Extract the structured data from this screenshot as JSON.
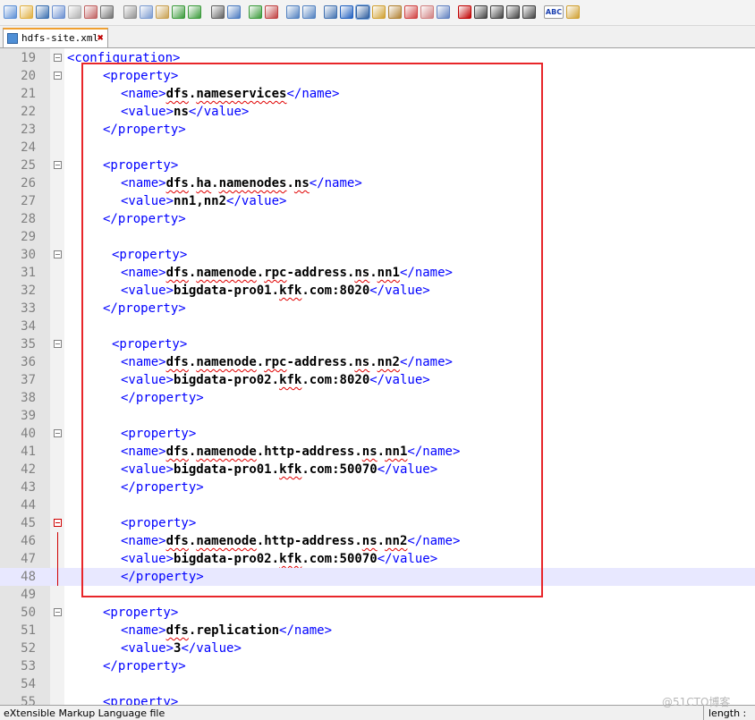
{
  "toolbar": {
    "icons": [
      "new-file-icon",
      "open-file-icon",
      "save-icon",
      "save-all-icon",
      "close-icon",
      "close-all-icon",
      "print-icon",
      "cut-icon",
      "copy-icon",
      "paste-icon",
      "undo-icon",
      "redo-icon",
      "find-icon",
      "replace-icon",
      "zoom-in-icon",
      "zoom-out-icon",
      "sync-vertical-icon",
      "sync-horizontal-icon",
      "word-wrap-icon",
      "show-all-characters-icon",
      "indent-guide-icon",
      "document-map-icon",
      "function-list-icon",
      "launch-icon",
      "folder-workspace-icon",
      "monitoring-icon",
      "record-macro-icon",
      "stop-macro-icon",
      "play-macro-icon",
      "run-macro-multiple-icon",
      "save-macro-icon",
      "spell-check-icon",
      "folder-icon"
    ],
    "spell_check_label": "ABC"
  },
  "tab": {
    "label": "hdfs-site.xml",
    "close_symbol": "✖"
  },
  "editor": {
    "lines": [
      {
        "num": "19",
        "fold": "minus",
        "fold_color": "gray",
        "indent": 0,
        "segments": [
          {
            "t": "tag",
            "v": "<configuration>"
          }
        ]
      },
      {
        "num": "20",
        "fold": "minus",
        "fold_color": "gray",
        "indent": 4,
        "segments": [
          {
            "t": "tag",
            "v": "<property>"
          }
        ]
      },
      {
        "num": "21",
        "fold": "",
        "fold_color": "gray",
        "indent": 6,
        "segments": [
          {
            "t": "tag",
            "v": "<name>"
          },
          {
            "t": "txt",
            "v": "dfs.nameservices"
          },
          {
            "t": "tag",
            "v": "</name>"
          }
        ]
      },
      {
        "num": "22",
        "fold": "",
        "fold_color": "gray",
        "indent": 6,
        "segments": [
          {
            "t": "tag",
            "v": "<value>"
          },
          {
            "t": "txt",
            "v": "ns"
          },
          {
            "t": "tag",
            "v": "</value>"
          }
        ]
      },
      {
        "num": "23",
        "fold": "",
        "fold_color": "gray",
        "indent": 4,
        "segments": [
          {
            "t": "tag",
            "v": "</property>"
          }
        ]
      },
      {
        "num": "24",
        "fold": "",
        "fold_color": "gray",
        "indent": 0,
        "segments": []
      },
      {
        "num": "25",
        "fold": "minus",
        "fold_color": "gray",
        "indent": 4,
        "segments": [
          {
            "t": "tag",
            "v": "<property>"
          }
        ]
      },
      {
        "num": "26",
        "fold": "",
        "fold_color": "gray",
        "indent": 6,
        "segments": [
          {
            "t": "tag",
            "v": "<name>"
          },
          {
            "t": "txt",
            "v": "dfs.ha.namenodes.ns"
          },
          {
            "t": "tag",
            "v": "</name>"
          }
        ]
      },
      {
        "num": "27",
        "fold": "",
        "fold_color": "gray",
        "indent": 6,
        "segments": [
          {
            "t": "tag",
            "v": "<value>"
          },
          {
            "t": "txt",
            "v": "nn1,nn2"
          },
          {
            "t": "tag",
            "v": "</value>"
          }
        ]
      },
      {
        "num": "28",
        "fold": "",
        "fold_color": "gray",
        "indent": 4,
        "segments": [
          {
            "t": "tag",
            "v": "</property>"
          }
        ]
      },
      {
        "num": "29",
        "fold": "",
        "fold_color": "gray",
        "indent": 0,
        "segments": []
      },
      {
        "num": "30",
        "fold": "minus",
        "fold_color": "gray",
        "indent": 5,
        "segments": [
          {
            "t": "tag",
            "v": "<property>"
          }
        ]
      },
      {
        "num": "31",
        "fold": "",
        "fold_color": "gray",
        "indent": 6,
        "segments": [
          {
            "t": "tag",
            "v": "<name>"
          },
          {
            "t": "txt",
            "v": "dfs.namenode.rpc-address.ns.nn1"
          },
          {
            "t": "tag",
            "v": "</name>"
          }
        ]
      },
      {
        "num": "32",
        "fold": "",
        "fold_color": "gray",
        "indent": 6,
        "segments": [
          {
            "t": "tag",
            "v": "<value>"
          },
          {
            "t": "txt",
            "v": "bigdata-pro01.kfk.com:8020"
          },
          {
            "t": "tag",
            "v": "</value>"
          }
        ]
      },
      {
        "num": "33",
        "fold": "",
        "fold_color": "gray",
        "indent": 4,
        "segments": [
          {
            "t": "tag",
            "v": "</property>"
          }
        ]
      },
      {
        "num": "34",
        "fold": "",
        "fold_color": "gray",
        "indent": 0,
        "segments": []
      },
      {
        "num": "35",
        "fold": "minus",
        "fold_color": "gray",
        "indent": 5,
        "segments": [
          {
            "t": "tag",
            "v": "<property>"
          }
        ]
      },
      {
        "num": "36",
        "fold": "",
        "fold_color": "gray",
        "indent": 6,
        "segments": [
          {
            "t": "tag",
            "v": "<name>"
          },
          {
            "t": "txt",
            "v": "dfs.namenode.rpc-address.ns.nn2"
          },
          {
            "t": "tag",
            "v": "</name>"
          }
        ]
      },
      {
        "num": "37",
        "fold": "",
        "fold_color": "gray",
        "indent": 6,
        "segments": [
          {
            "t": "tag",
            "v": "<value>"
          },
          {
            "t": "txt",
            "v": "bigdata-pro02.kfk.com:8020"
          },
          {
            "t": "tag",
            "v": "</value>"
          }
        ]
      },
      {
        "num": "38",
        "fold": "",
        "fold_color": "gray",
        "indent": 6,
        "segments": [
          {
            "t": "tag",
            "v": "</property>"
          }
        ]
      },
      {
        "num": "39",
        "fold": "",
        "fold_color": "gray",
        "indent": 0,
        "segments": []
      },
      {
        "num": "40",
        "fold": "minus",
        "fold_color": "gray",
        "indent": 6,
        "segments": [
          {
            "t": "tag",
            "v": "<property>"
          }
        ]
      },
      {
        "num": "41",
        "fold": "",
        "fold_color": "gray",
        "indent": 6,
        "segments": [
          {
            "t": "tag",
            "v": "<name>"
          },
          {
            "t": "txt",
            "v": "dfs.namenode.http-address.ns.nn1"
          },
          {
            "t": "tag",
            "v": "</name>"
          }
        ]
      },
      {
        "num": "42",
        "fold": "",
        "fold_color": "gray",
        "indent": 6,
        "segments": [
          {
            "t": "tag",
            "v": "<value>"
          },
          {
            "t": "txt",
            "v": "bigdata-pro01.kfk.com:50070"
          },
          {
            "t": "tag",
            "v": "</value>"
          }
        ]
      },
      {
        "num": "43",
        "fold": "",
        "fold_color": "gray",
        "indent": 6,
        "segments": [
          {
            "t": "tag",
            "v": "</property>"
          }
        ]
      },
      {
        "num": "44",
        "fold": "",
        "fold_color": "gray",
        "indent": 0,
        "segments": []
      },
      {
        "num": "45",
        "fold": "minus",
        "fold_color": "red",
        "indent": 6,
        "segments": [
          {
            "t": "tag",
            "v": "<property>"
          }
        ]
      },
      {
        "num": "46",
        "fold": "",
        "fold_color": "red",
        "indent": 6,
        "segments": [
          {
            "t": "tag",
            "v": "<name>"
          },
          {
            "t": "txt",
            "v": "dfs.namenode.http-address.ns.nn2"
          },
          {
            "t": "tag",
            "v": "</name>"
          }
        ]
      },
      {
        "num": "47",
        "fold": "",
        "fold_color": "red",
        "indent": 6,
        "segments": [
          {
            "t": "tag",
            "v": "<value>"
          },
          {
            "t": "txt",
            "v": "bigdata-pro02.kfk.com:50070"
          },
          {
            "t": "tag",
            "v": "</value>"
          }
        ]
      },
      {
        "num": "48",
        "fold": "",
        "fold_color": "red",
        "indent": 6,
        "current": true,
        "segments": [
          {
            "t": "tag",
            "v": "</property>"
          }
        ]
      },
      {
        "num": "49",
        "fold": "",
        "fold_color": "gray",
        "indent": 0,
        "segments": []
      },
      {
        "num": "50",
        "fold": "minus",
        "fold_color": "gray",
        "indent": 4,
        "segments": [
          {
            "t": "tag",
            "v": "<property>"
          }
        ]
      },
      {
        "num": "51",
        "fold": "",
        "fold_color": "gray",
        "indent": 6,
        "segments": [
          {
            "t": "tag",
            "v": "<name>"
          },
          {
            "t": "txt",
            "v": "dfs.replication"
          },
          {
            "t": "tag",
            "v": "</name>"
          }
        ]
      },
      {
        "num": "52",
        "fold": "",
        "fold_color": "gray",
        "indent": 6,
        "segments": [
          {
            "t": "tag",
            "v": "<value>"
          },
          {
            "t": "txt",
            "v": "3"
          },
          {
            "t": "tag",
            "v": "</value>"
          }
        ]
      },
      {
        "num": "53",
        "fold": "",
        "fold_color": "gray",
        "indent": 4,
        "segments": [
          {
            "t": "tag",
            "v": "</property>"
          }
        ]
      },
      {
        "num": "54",
        "fold": "",
        "fold_color": "gray",
        "indent": 0,
        "segments": []
      },
      {
        "num": "55",
        "fold": "",
        "fold_color": "gray",
        "indent": 4,
        "segments": [
          {
            "t": "tag",
            "v": "<property>"
          }
        ]
      }
    ]
  },
  "status": {
    "language": "eXtensible Markup Language file",
    "length_label": "length :"
  },
  "watermark": "@51CTO博客",
  "colors": {
    "tag": "#0000ff",
    "text": "#000000",
    "highlight_box": "#e8262a",
    "current_line": "#e8e8ff",
    "tab_accent": "#f0a030"
  }
}
